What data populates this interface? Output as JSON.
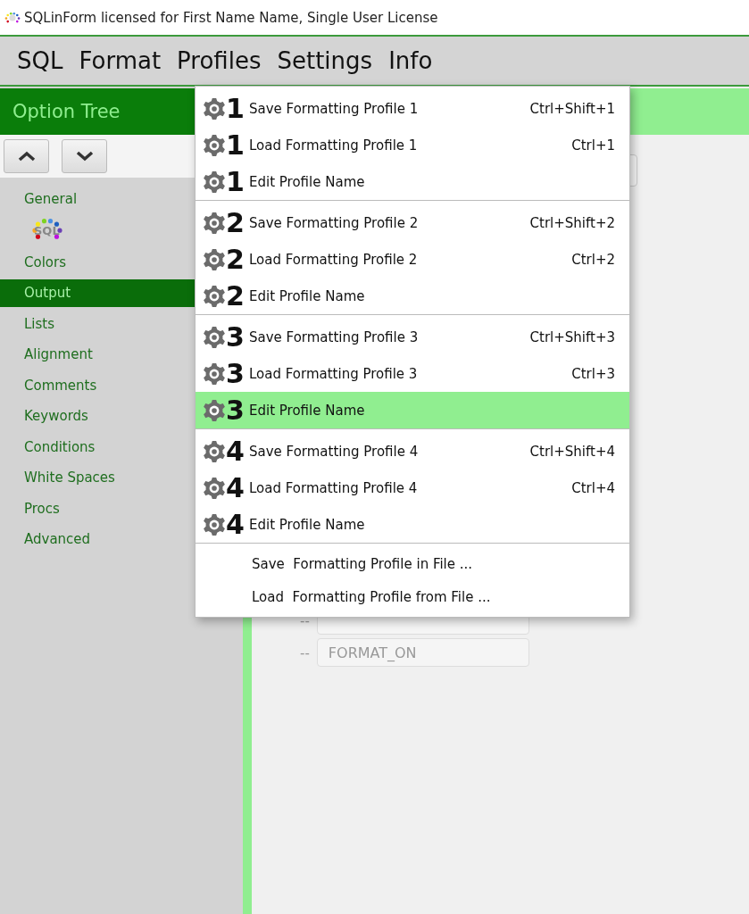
{
  "window": {
    "title": "SQLinForm licensed for First Name Name, Single User License"
  },
  "menu_bar": [
    "SQL",
    "Format",
    "Profiles",
    "Settings",
    "Info"
  ],
  "sidebar": {
    "title": "Option Tree",
    "logo_text": "SQL",
    "items": [
      {
        "label": "General",
        "selected": false,
        "logo": true
      },
      {
        "label": "Colors",
        "selected": false
      },
      {
        "label": "Output",
        "selected": true
      },
      {
        "label": "Lists",
        "selected": false
      },
      {
        "label": "Alignment",
        "selected": false
      },
      {
        "label": "Comments",
        "selected": false
      },
      {
        "label": "Keywords",
        "selected": false
      },
      {
        "label": "Conditions",
        "selected": false
      },
      {
        "label": "White Spaces",
        "selected": false
      },
      {
        "label": "Procs",
        "selected": false
      },
      {
        "label": "Advanced",
        "selected": false
      }
    ]
  },
  "content": {
    "markers": [
      {
        "prefix": "--"
      },
      {
        "prefix": "--",
        "value": "FORMAT_ON"
      }
    ]
  },
  "profiles_menu": {
    "groups": [
      {
        "items": [
          {
            "kind": "profile",
            "number": "1",
            "label": "Save Formatting Profile 1",
            "shortcut": "Ctrl+Shift+1",
            "selected": false
          },
          {
            "kind": "profile",
            "number": "1",
            "label": "Load Formatting Profile 1",
            "shortcut": "Ctrl+1",
            "selected": false
          },
          {
            "kind": "profile",
            "number": "1",
            "label": "Edit Profile Name",
            "selected": false
          }
        ]
      },
      {
        "items": [
          {
            "kind": "profile",
            "number": "2",
            "label": "Save Formatting Profile 2",
            "shortcut": "Ctrl+Shift+2",
            "selected": false
          },
          {
            "kind": "profile",
            "number": "2",
            "label": "Load Formatting Profile 2",
            "shortcut": "Ctrl+2",
            "selected": false
          },
          {
            "kind": "profile",
            "number": "2",
            "label": "Edit Profile Name",
            "selected": false
          }
        ]
      },
      {
        "items": [
          {
            "kind": "profile",
            "number": "3",
            "label": "Save Formatting Profile 3",
            "shortcut": "Ctrl+Shift+3",
            "selected": false
          },
          {
            "kind": "profile",
            "number": "3",
            "label": "Load Formatting Profile 3",
            "shortcut": "Ctrl+3",
            "selected": false
          },
          {
            "kind": "profile",
            "number": "3",
            "label": "Edit Profile Name",
            "selected": true
          }
        ]
      },
      {
        "items": [
          {
            "kind": "profile",
            "number": "4",
            "label": "Save Formatting Profile 4",
            "shortcut": "Ctrl+Shift+4",
            "selected": false
          },
          {
            "kind": "profile",
            "number": "4",
            "label": "Load Formatting Profile 4",
            "shortcut": "Ctrl+4",
            "selected": false
          },
          {
            "kind": "profile",
            "number": "4",
            "label": "Edit Profile Name",
            "selected": false
          }
        ]
      },
      {
        "items": [
          {
            "kind": "file",
            "label": "Save  Formatting Profile in File ...",
            "selected": false
          },
          {
            "kind": "file",
            "label": "Load  Formatting Profile from File ...",
            "selected": false
          }
        ]
      }
    ]
  }
}
